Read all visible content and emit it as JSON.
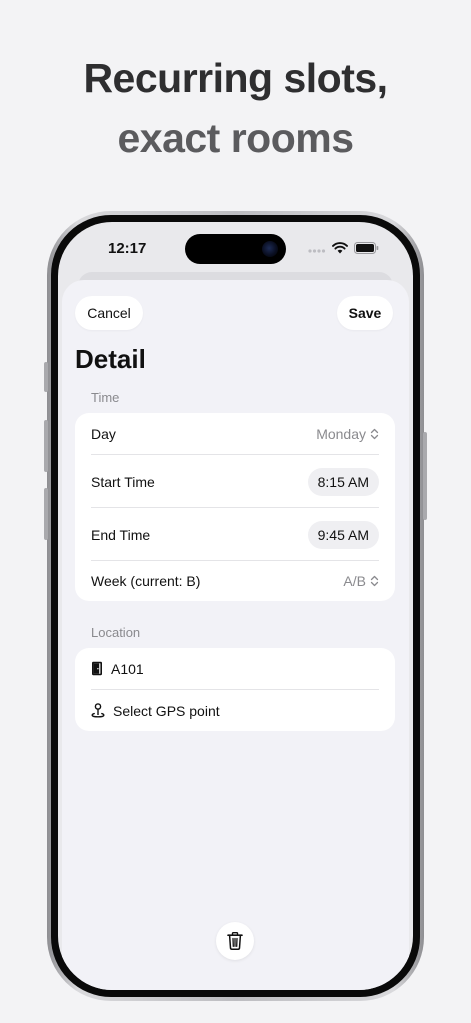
{
  "headline": {
    "line1": "Recurring slots,",
    "line2": "exact rooms"
  },
  "status_bar": {
    "time": "12:17"
  },
  "nav": {
    "cancel_label": "Cancel",
    "save_label": "Save"
  },
  "page_title": "Detail",
  "time_section": {
    "label": "Time",
    "day_label": "Day",
    "day_value": "Monday",
    "start_label": "Start Time",
    "start_value": "8:15 AM",
    "end_label": "End Time",
    "end_value": "9:45 AM",
    "week_label": "Week (current: B)",
    "week_value": "A/B"
  },
  "location_section": {
    "label": "Location",
    "room": "A101",
    "gps_label": "Select GPS point"
  },
  "icons": {
    "room": "door-icon",
    "gps": "pin-icon",
    "delete": "trash-icon",
    "stepper": "chevron-up-down-icon"
  },
  "colors": {
    "background": "#f3f3f5",
    "sheet": "#f2f2f7",
    "secondary_text": "#8a8a8e"
  }
}
